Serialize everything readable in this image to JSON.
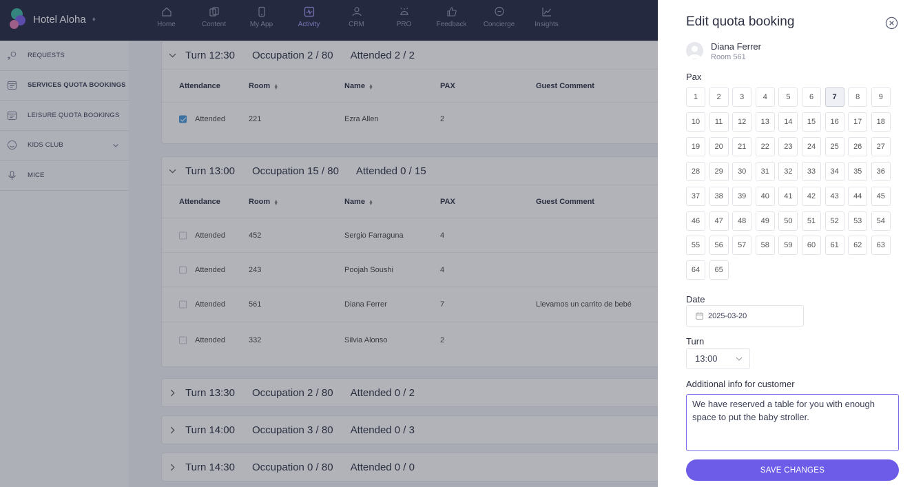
{
  "brand": {
    "name": "Hotel Aloha",
    "switch_glyph": "♦"
  },
  "nav": [
    {
      "label": "Home",
      "icon": "home-icon"
    },
    {
      "label": "Content",
      "icon": "content-icon"
    },
    {
      "label": "My App",
      "icon": "phone-icon"
    },
    {
      "label": "Activity",
      "icon": "activity-icon",
      "active": true
    },
    {
      "label": "CRM",
      "icon": "people-icon"
    },
    {
      "label": "PRO",
      "icon": "bell-icon"
    },
    {
      "label": "Feedback",
      "icon": "thumbs-up-icon"
    },
    {
      "label": "Concierge",
      "icon": "chat-icon"
    },
    {
      "label": "Insights",
      "icon": "chart-icon"
    }
  ],
  "sidebar": [
    {
      "label": "Requests",
      "icon": "requests-icon"
    },
    {
      "label": "Services quota bookings",
      "icon": "calendar-icon",
      "active": true
    },
    {
      "label": "Leisure quota bookings",
      "icon": "calendar-icon"
    },
    {
      "label": "Kids club",
      "icon": "smile-icon",
      "expandable": true
    },
    {
      "label": "MICE",
      "icon": "microphone-icon"
    }
  ],
  "table_headers": {
    "attendance": "Attendance",
    "room": "Room",
    "name": "Name",
    "pax": "PAX",
    "comment": "Guest Comment"
  },
  "sort_glyph": "▲▼",
  "turns": [
    {
      "label": "Turn 12:30",
      "occupation": "Occupation 2 / 80",
      "attended": "Attended 2 / 2",
      "expanded": true,
      "rows": [
        {
          "attendance": "Attended",
          "checked": true,
          "room": "221",
          "name": "Ezra Allen",
          "pax": "2",
          "comment": ""
        }
      ]
    },
    {
      "label": "Turn 13:00",
      "occupation": "Occupation 15 / 80",
      "attended": "Attended 0 / 15",
      "expanded": true,
      "rows": [
        {
          "attendance": "Attended",
          "checked": false,
          "room": "452",
          "name": "Sergio Farraguna",
          "pax": "4",
          "comment": ""
        },
        {
          "attendance": "Attended",
          "checked": false,
          "room": "243",
          "name": "Poojah Soushi",
          "pax": "4",
          "comment": ""
        },
        {
          "attendance": "Attended",
          "checked": false,
          "room": "561",
          "name": "Diana Ferrer",
          "pax": "7",
          "comment": "Llevamos un carrito de bebé"
        },
        {
          "attendance": "Attended",
          "checked": false,
          "room": "332",
          "name": "Silvia Alonso",
          "pax": "2",
          "comment": ""
        }
      ]
    },
    {
      "label": "Turn 13:30",
      "occupation": "Occupation 2 / 80",
      "attended": "Attended 0 / 2",
      "expanded": false,
      "rows": []
    },
    {
      "label": "Turn 14:00",
      "occupation": "Occupation 3 / 80",
      "attended": "Attended 0 / 3",
      "expanded": false,
      "rows": []
    },
    {
      "label": "Turn 14:30",
      "occupation": "Occupation 0 / 80",
      "attended": "Attended 0 / 0",
      "expanded": false,
      "rows": []
    }
  ],
  "drawer": {
    "title": "Edit quota booking",
    "guest_name": "Diana Ferrer",
    "guest_room": "Room 561",
    "pax_label": "Pax",
    "pax_max": 65,
    "pax_selected": 7,
    "date_label": "Date",
    "date_value": "2025-03-20",
    "turn_label": "Turn",
    "turn_value": "13:00",
    "info_label": "Additional info for customer",
    "info_value": "We have reserved a table for you with enough space to put the baby stroller.",
    "save_label": "SAVE CHANGES"
  },
  "colors": {
    "accent": "#6c5ce7",
    "topbar": "#242842",
    "active_nav": "#a79bf5",
    "checkbox_on": "#4a9ad8"
  }
}
